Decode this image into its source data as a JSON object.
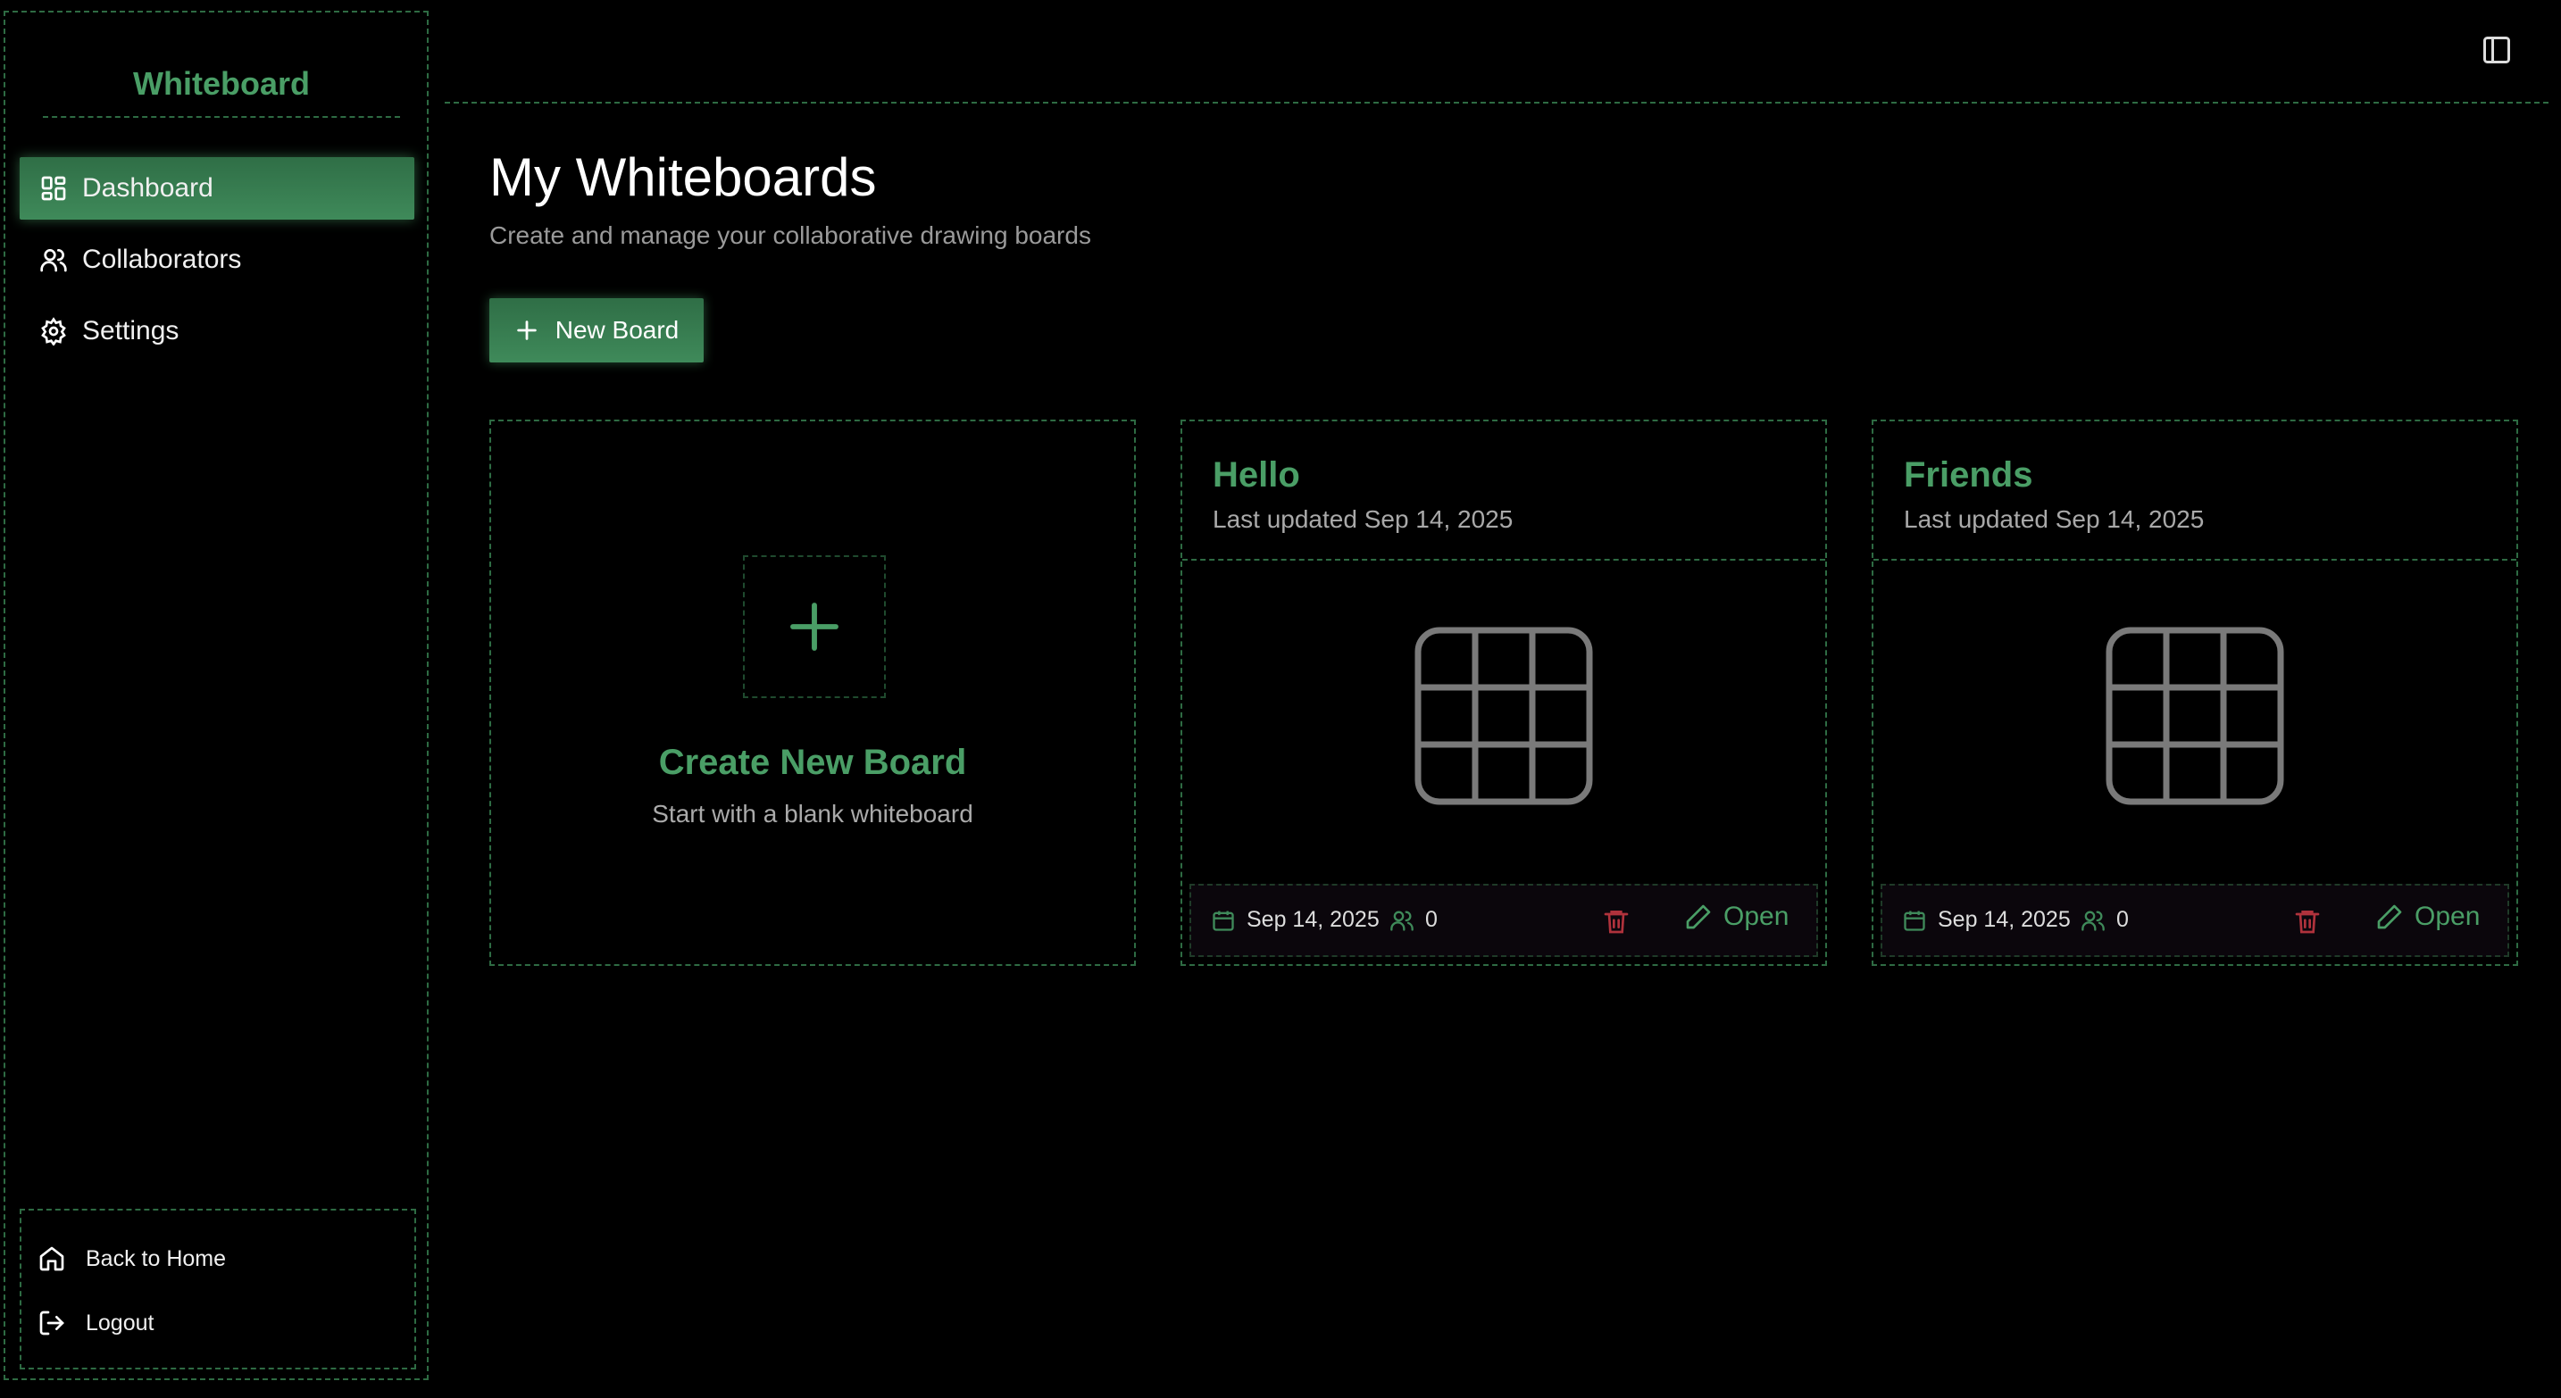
{
  "sidebar": {
    "brand": "Whiteboard",
    "nav": [
      {
        "label": "Dashboard",
        "icon": "dashboard-icon",
        "active": true
      },
      {
        "label": "Collaborators",
        "icon": "users-icon",
        "active": false
      },
      {
        "label": "Settings",
        "icon": "gear-icon",
        "active": false
      }
    ],
    "bottom": [
      {
        "label": "Back to Home",
        "icon": "home-icon"
      },
      {
        "label": "Logout",
        "icon": "logout-icon"
      }
    ]
  },
  "header": {
    "title": "My Whiteboards",
    "subtitle": "Create and manage your collaborative drawing boards",
    "new_board_label": "New Board"
  },
  "create_card": {
    "title": "Create New Board",
    "subtitle": "Start with a blank whiteboard"
  },
  "boards": [
    {
      "title": "Hello",
      "updated": "Last updated Sep 14, 2025",
      "date": "Sep 14, 2025",
      "collaborators": "0",
      "open_label": "Open"
    },
    {
      "title": "Friends",
      "updated": "Last updated Sep 14, 2025",
      "date": "Sep 14, 2025",
      "collaborators": "0",
      "open_label": "Open"
    }
  ],
  "colors": {
    "accent": "#4a9e66",
    "border": "#2e6b43",
    "danger": "#b0323c",
    "background": "#000000"
  }
}
